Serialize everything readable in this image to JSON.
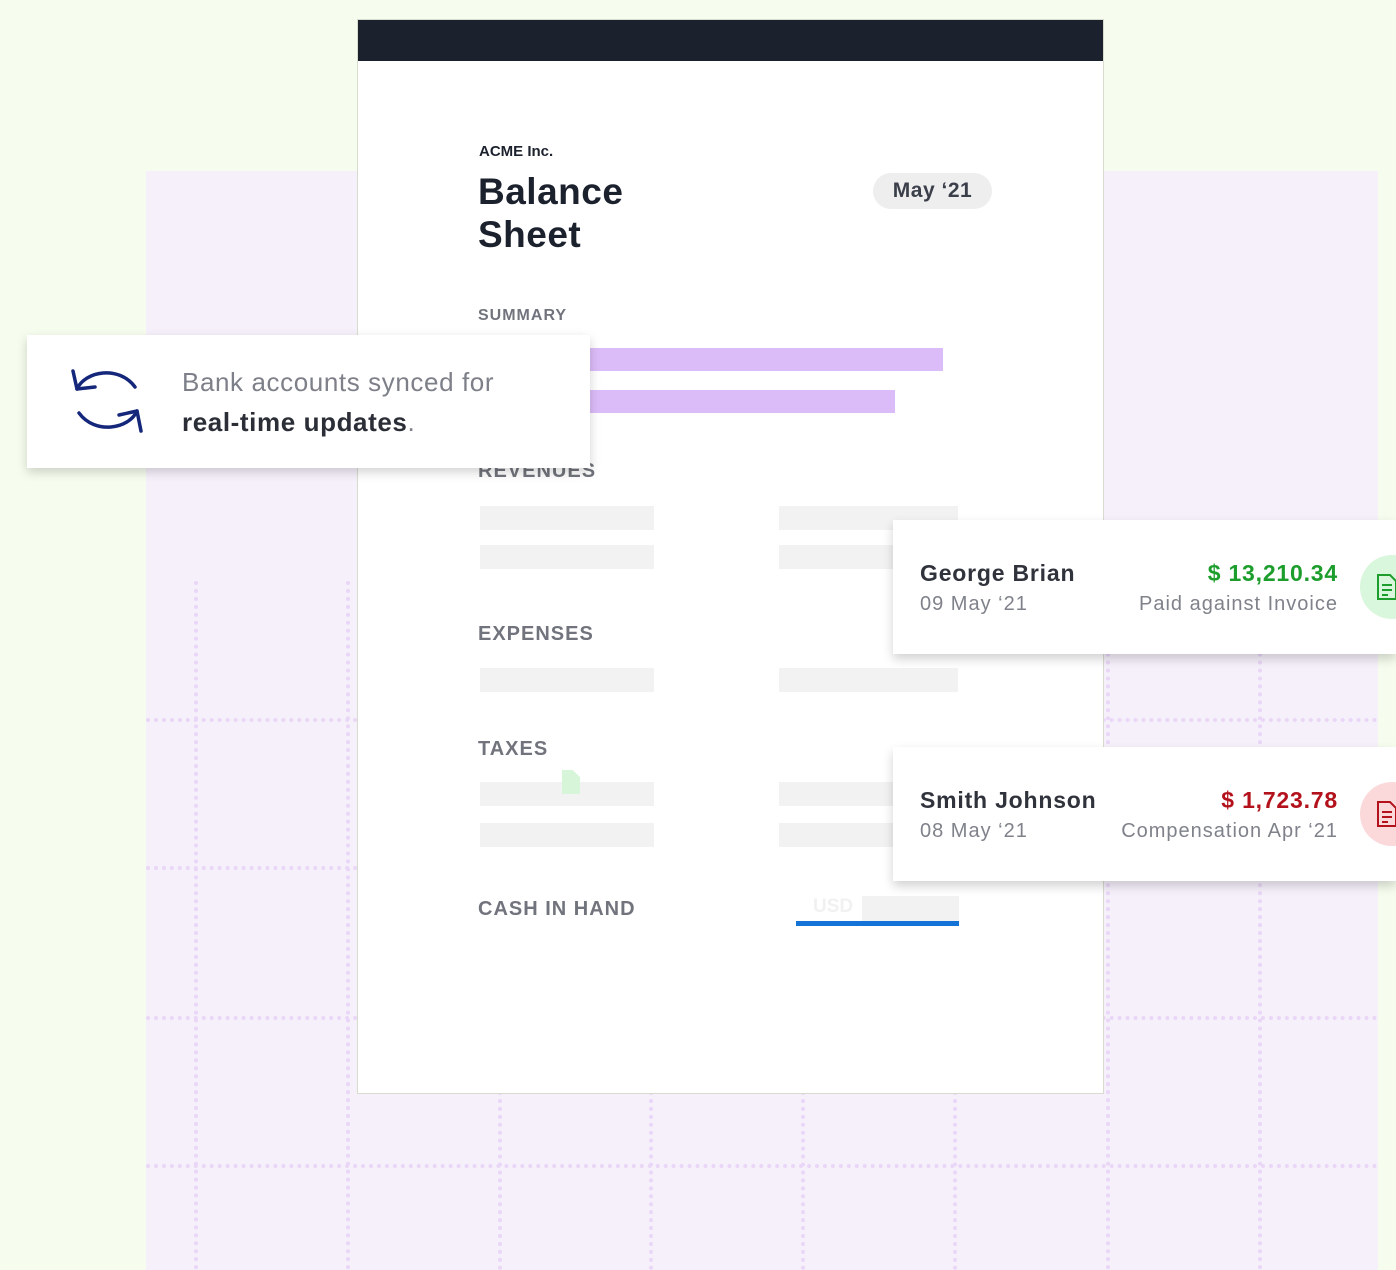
{
  "colors": {
    "page_background": "#f6fdee",
    "panel_background": "#f6f0fb",
    "sheet_header": "#1c212e",
    "summary_bar": "#dcbcf8",
    "cash_underline": "#1473d6",
    "sync_icon": "#14277a",
    "paid_green": "#1c9d2c",
    "compensation_red": "#b3121c"
  },
  "sheet": {
    "company": "ACME Inc.",
    "title": "Balance Sheet",
    "period": "May ‘21",
    "sections": {
      "summary": "SUMMARY",
      "revenues": "REVENUES",
      "expenses": "EXPENSES",
      "taxes": "TAXES",
      "cash_in_hand": "CASH IN HAND"
    },
    "cash_currency": "USD"
  },
  "sync_notice": {
    "icon": "sync-icon",
    "text_line1": "Bank accounts synced for",
    "text_bold": "real-time updates",
    "text_suffix": "."
  },
  "transactions": [
    {
      "name": "George Brian",
      "date": "09 May ‘21",
      "amount": "$ 13,210.34",
      "description": "Paid against Invoice",
      "icon": "document-icon"
    },
    {
      "name": "Smith Johnson",
      "date": "08 May ‘21",
      "amount": "$ 1,723.78",
      "description": "Compensation Apr ‘21",
      "icon": "document-icon"
    }
  ]
}
